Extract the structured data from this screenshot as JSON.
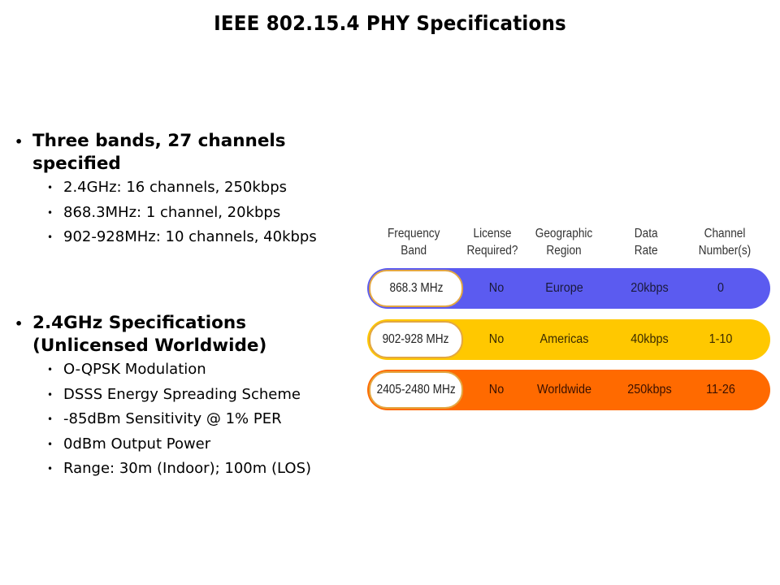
{
  "slide": {
    "title": "IEEE 802.15.4 PHY Specifications"
  },
  "bullets": [
    {
      "heading": [
        "Three bands, 27 channels",
        "specified"
      ],
      "items": [
        "2.4GHz: 16 channels, 250kbps",
        "868.3MHz: 1 channel, 20kbps",
        "902-928MHz: 10 channels, 40kbps"
      ]
    },
    {
      "heading": [
        "2.4GHz Specifications",
        "(Unlicensed Worldwide)"
      ],
      "items": [
        "O-QPSK Modulation",
        "DSSS Energy Spreading Scheme",
        "-85dBm Sensitivity @ 1% PER",
        "0dBm Output Power",
        "Range: 30m (Indoor); 100m (LOS)"
      ]
    }
  ],
  "table": {
    "headers": [
      [
        "Frequency",
        "Band"
      ],
      [
        "License",
        "Required?"
      ],
      [
        "Geographic",
        "Region"
      ],
      [
        "Data",
        "Rate"
      ],
      [
        "Channel",
        "Number(s)"
      ]
    ],
    "rows": [
      {
        "band": "868.3 MHz",
        "license": "No",
        "region": "Europe",
        "rate": "20kbps",
        "channels": "0",
        "color": "#5b5bf0",
        "text_color": "#1a1a3a"
      },
      {
        "band": "902-928 MHz",
        "license": "No",
        "region": "Americas",
        "rate": "40kbps",
        "channels": "1-10",
        "color": "#ffc800",
        "text_color": "#3a2a00"
      },
      {
        "band": "2405-2480 MHz",
        "license": "No",
        "region": "Worldwide",
        "rate": "250kbps",
        "channels": "11-26",
        "color": "#ff6a00",
        "text_color": "#3a1000"
      }
    ],
    "band_border_color": "#e3a742"
  }
}
